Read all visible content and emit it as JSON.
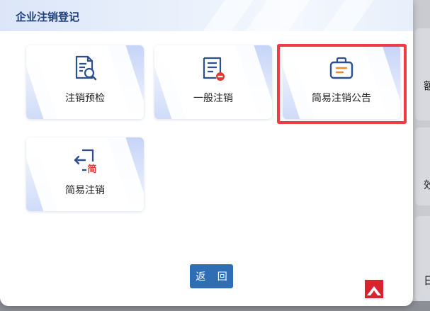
{
  "dialog": {
    "title": "企业注销登记",
    "back_label": "返 回"
  },
  "tiles": [
    {
      "label": "注销预检",
      "icon": "document-search-icon"
    },
    {
      "label": "一般注销",
      "icon": "document-remove-icon"
    },
    {
      "label": "简易注销公告",
      "icon": "announcement-bag-icon",
      "highlighted": true
    },
    {
      "label": "简易注销",
      "icon": "simple-exit-icon",
      "badge": "简"
    }
  ],
  "background": {
    "chars": [
      "额",
      "效",
      "日"
    ]
  },
  "colors": {
    "accent": "#2f6db4",
    "icon_blue": "#2c4f8f",
    "icon_red": "#e2382f",
    "highlight": "#ee3b44"
  }
}
